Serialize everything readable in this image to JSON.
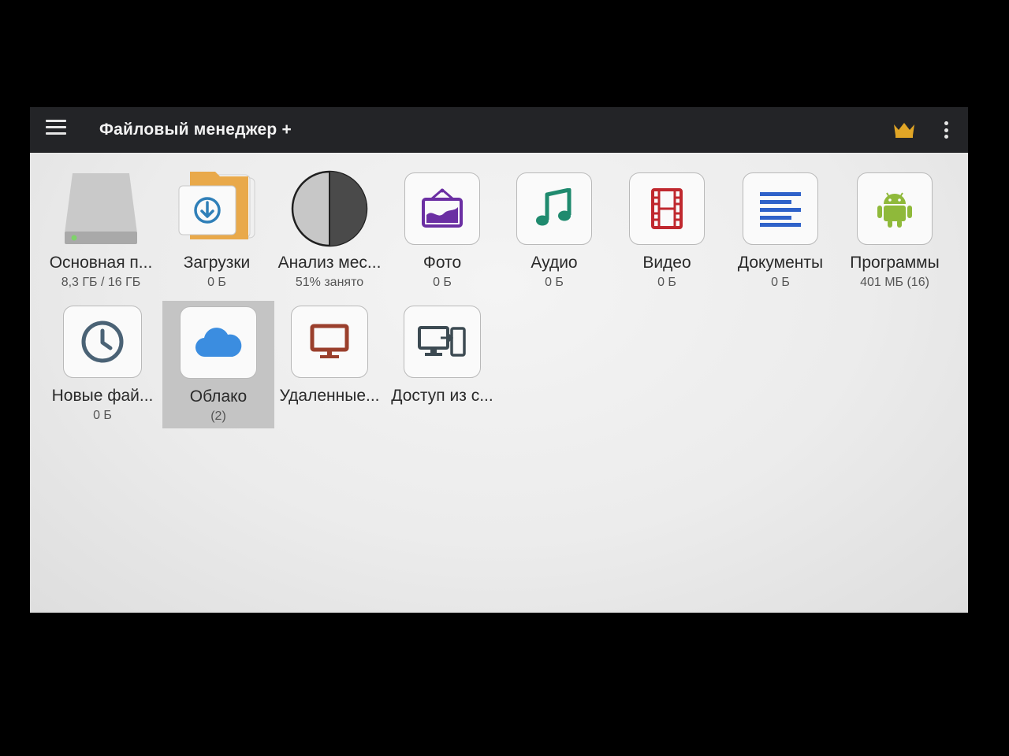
{
  "appbar": {
    "title": "Файловый менеджер +",
    "menu_icon": "menu-icon",
    "premium_icon": "crown-icon",
    "more_icon": "more-vert-icon"
  },
  "colors": {
    "appbar_bg": "#232427",
    "content_bg": "#ececec",
    "selection_bg": "#c4c4c4",
    "crown": "#e0a526",
    "photo": "#6b2fa3",
    "audio": "#1f8a6e",
    "video": "#c0282e",
    "docs": "#2f62c9",
    "android": "#8fb93a",
    "cloud": "#3b8de0",
    "remote": "#9a3f2c",
    "clock": "#4a6275"
  },
  "tiles": [
    {
      "label": "Основная п...",
      "sub": "8,3 ГБ / 16 ГБ",
      "icon": "hard-drive-icon"
    },
    {
      "label": "Загрузки",
      "sub": "0 Б",
      "icon": "download-folder-icon"
    },
    {
      "label": "Анализ мес...",
      "sub": "51% занято",
      "icon": "pie-chart-icon",
      "used_percent": 51
    },
    {
      "label": "Фото",
      "sub": "0 Б",
      "icon": "photo-icon"
    },
    {
      "label": "Аудио",
      "sub": "0 Б",
      "icon": "music-note-icon"
    },
    {
      "label": "Видео",
      "sub": "0 Б",
      "icon": "film-icon"
    },
    {
      "label": "Документы",
      "sub": "0 Б",
      "icon": "document-lines-icon"
    },
    {
      "label": "Программы",
      "sub": "401 МБ (16)",
      "icon": "android-icon"
    },
    {
      "label": "Новые фай...",
      "sub": "0 Б",
      "icon": "clock-icon"
    },
    {
      "label": "Облако",
      "sub": "(2)",
      "icon": "cloud-icon",
      "selected": true
    },
    {
      "label": "Удаленные...",
      "sub": "",
      "icon": "monitor-icon"
    },
    {
      "label": "Доступ из с...",
      "sub": "",
      "icon": "devices-transfer-icon"
    }
  ]
}
